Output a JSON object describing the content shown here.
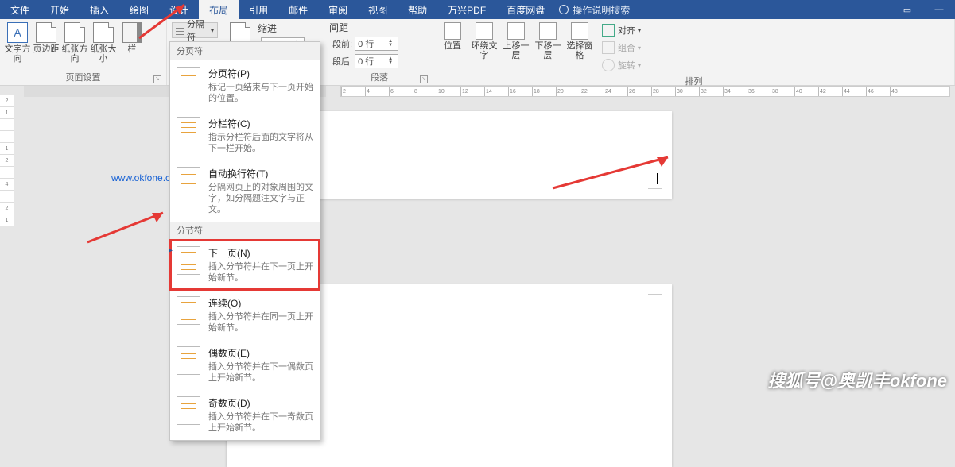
{
  "tabs": [
    "文件",
    "开始",
    "插入",
    "绘图",
    "设计",
    "布局",
    "引用",
    "邮件",
    "审阅",
    "视图",
    "帮助",
    "万兴PDF",
    "百度网盘"
  ],
  "active_tab_index": 5,
  "search_hint": "操作说明搜索",
  "page_setup": {
    "group_label": "页面设置",
    "buttons": {
      "text_dir": "文字方向",
      "margins": "页边距",
      "orientation": "纸张方向",
      "size": "纸张大小",
      "columns": "栏"
    },
    "breaks_label": "分隔符"
  },
  "indent": {
    "heading": "缩进"
  },
  "spacing": {
    "heading": "间距",
    "before_label": "段前:",
    "before_value": "0 行",
    "after_label": "段后:",
    "after_value": "0 行",
    "group_label": "段落"
  },
  "arrange": {
    "group_label": "排列",
    "position": "位置",
    "wrap": "环绕文\n字",
    "forward": "上移一层",
    "backward": "下移一层",
    "pane": "选择窗格",
    "align": "对齐",
    "group": "组合",
    "rotate": "旋转"
  },
  "dropdown": {
    "section_a": "分页符",
    "items_a": [
      {
        "title": "分页符(P)",
        "desc": "标记一页结束与下一页开始的位置。"
      },
      {
        "title": "分栏符(C)",
        "desc": "指示分栏符后面的文字将从下一栏开始。"
      },
      {
        "title": "自动换行符(T)",
        "desc": "分隔网页上的对象周围的文字，如分隔题注文字与正文。"
      }
    ],
    "section_b": "分节符",
    "items_b": [
      {
        "title": "下一页(N)",
        "desc": "插入分节符并在下一页上开始新节。"
      },
      {
        "title": "连续(O)",
        "desc": "插入分节符并在同一页上开始新节。"
      },
      {
        "title": "偶数页(E)",
        "desc": "插入分节符并在下一偶数页上开始新节。"
      },
      {
        "title": "奇数页(D)",
        "desc": "插入分节符并在下一奇数页上开始新节。"
      }
    ]
  },
  "ruler_top_ticks": [
    2,
    4,
    6,
    8,
    10,
    12,
    14,
    16,
    18,
    20,
    22,
    24,
    26,
    28,
    30,
    32,
    34,
    36,
    38,
    40,
    42,
    44,
    46,
    48
  ],
  "ruler_left_ticks": [
    2,
    1,
    "",
    "",
    1,
    2,
    "",
    4,
    "",
    2,
    1
  ],
  "watermark_url": "www.okfone.com",
  "credit": "搜狐号@奥凯丰okfone"
}
